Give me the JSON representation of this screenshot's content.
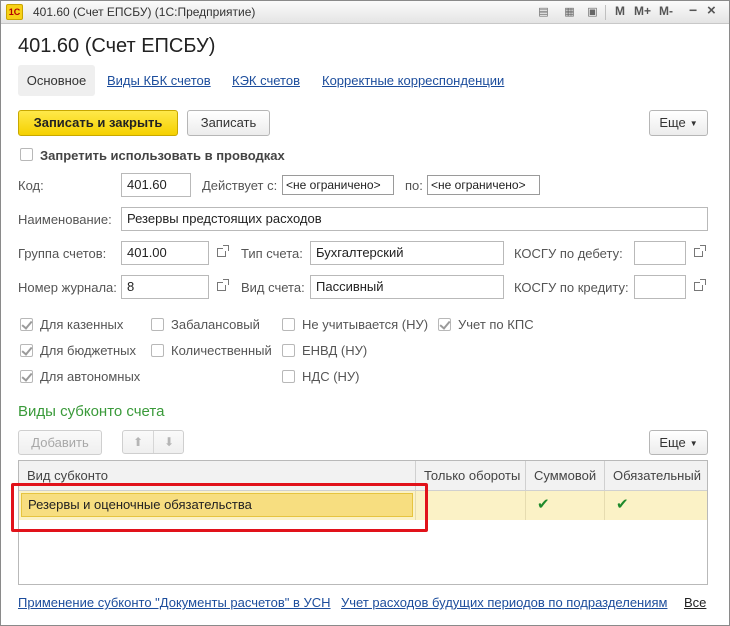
{
  "window": {
    "title": "401.60 (Счет ЕПСБУ)  (1С:Предприятие)",
    "logo": "1С",
    "buttons": {
      "m": "M",
      "mplus": "M+",
      "mminus": "M-",
      "minimize": "−",
      "restore": "□",
      "close": "×"
    }
  },
  "form": {
    "title": "401.60 (Счет ЕПСБУ)"
  },
  "tabs": [
    {
      "label": "Основное"
    },
    {
      "label": "Виды КБК счетов"
    },
    {
      "label": "КЭК счетов"
    },
    {
      "label": "Корректные корреспонденции"
    }
  ],
  "toolbar": {
    "save_close": "Записать и закрыть",
    "save": "Записать",
    "more": "Еще"
  },
  "forbid": {
    "label": "Запретить использовать в проводках"
  },
  "fields": {
    "code_label": "Код:",
    "code": "401.60",
    "valid_from_label": "Действует с:",
    "valid_from": "<не ограничено>",
    "valid_to_label": "по:",
    "valid_to": "<не ограничено>",
    "name_label": "Наименование:",
    "name": "Резервы предстоящих расходов",
    "group_label": "Группа счетов:",
    "group": "401.00",
    "type_label": "Тип счета:",
    "type": "Бухгалтерский",
    "kosgu_debit_label": "КОСГУ по дебету:",
    "kosgu_debit": "",
    "journal_label": "Номер журнала:",
    "journal": "8",
    "kind_label": "Вид счета:",
    "kind": "Пассивный",
    "kosgu_credit_label": "КОСГУ по кредиту:",
    "kosgu_credit": ""
  },
  "checks": {
    "kazennyh": {
      "label": "Для казенных",
      "checked": true
    },
    "byudzhetnyh": {
      "label": "Для бюджетных",
      "checked": true
    },
    "avtonomnyh": {
      "label": "Для автономных",
      "checked": true
    },
    "zabalansovyj": {
      "label": "Забалансовый",
      "checked": false
    },
    "kolichestvennyj": {
      "label": "Количественный",
      "checked": false
    },
    "ne_uchityvaetsya": {
      "label": "Не учитывается (НУ)",
      "checked": false
    },
    "envd": {
      "label": "ЕНВД (НУ)",
      "checked": false
    },
    "nds": {
      "label": "НДС (НУ)",
      "checked": false
    },
    "kps": {
      "label": "Учет по КПС",
      "checked": true
    }
  },
  "subkonto": {
    "section_title": "Виды субконто счета",
    "add": "Добавить",
    "up_icon": "arrow-up-icon",
    "down_icon": "arrow-down-icon",
    "more": "Еще",
    "columns": [
      "Вид субконто",
      "Только обороты",
      "Суммовой",
      "Обязательный"
    ],
    "rows": [
      {
        "kind": "Резервы и оценочные обязательства",
        "turnover_only": false,
        "summ": true,
        "required": true
      }
    ],
    "check_glyph": "✔"
  },
  "links": {
    "apply": "Применение субконто \"Документы расчетов\" в УСН",
    "future": "Учет расходов будущих периодов по подразделениям",
    "all": "Все"
  },
  "colors": {
    "accent": "#f5d100",
    "link": "#1c4d9c",
    "section": "#3a9a3a",
    "highlight": "#e1121a",
    "row_selected": "#fbf2c6"
  }
}
